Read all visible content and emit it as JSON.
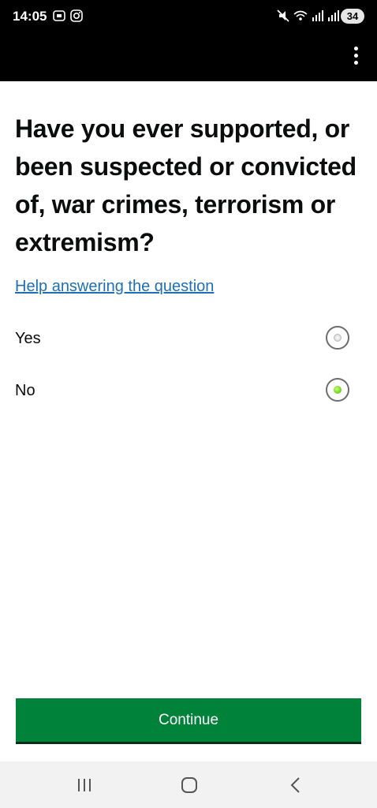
{
  "status_bar": {
    "time": "14:05",
    "battery": "34",
    "icons": [
      "screenshot-icon",
      "instagram-icon",
      "mute-icon",
      "wifi-icon",
      "signal-icon",
      "signal-icon"
    ]
  },
  "app_bar": {
    "menu_icon": "more-vertical-icon"
  },
  "question": {
    "title": "Have you ever supported, or been suspected or convicted of, war crimes, terrorism or extremism?",
    "help_link": "Help answering the question"
  },
  "options": [
    {
      "label": "Yes",
      "selected": false
    },
    {
      "label": "No",
      "selected": true
    }
  ],
  "continue_label": "Continue",
  "nav_bar": {
    "icons": [
      "recent-apps-icon",
      "home-icon",
      "back-icon"
    ]
  },
  "colors": {
    "link": "#1d70b8",
    "button": "#00823b",
    "radio_selected": "#74d61c"
  }
}
